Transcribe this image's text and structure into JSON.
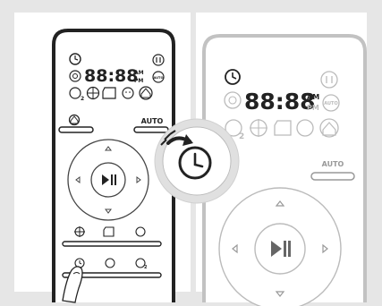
{
  "left_remote": {
    "display": {
      "time": "88:88",
      "am": "AM",
      "pm": "PM",
      "auto_badge": "AUTO",
      "sub_two": "2"
    },
    "buttons": {
      "auto_label": "AUTO",
      "sub_two": "2"
    }
  },
  "right_remote": {
    "display": {
      "time": "88:88",
      "am": "AM",
      "pm": "PM",
      "auto_badge": "AUTO",
      "sub_two": "2"
    },
    "buttons": {
      "auto_label": "AUTO"
    }
  },
  "colors": {
    "frame_gray": "#e6e6e6",
    "outline_dark": "#222222",
    "faded_gray": "#b8b8b8"
  },
  "icons": [
    "clock-icon",
    "pause-icon",
    "spot-icon",
    "auto-icon",
    "edge-icon",
    "target-icon",
    "room-icon",
    "face-icon",
    "home-icon",
    "play-pause-icon",
    "arrow-icon",
    "hand-icon"
  ]
}
